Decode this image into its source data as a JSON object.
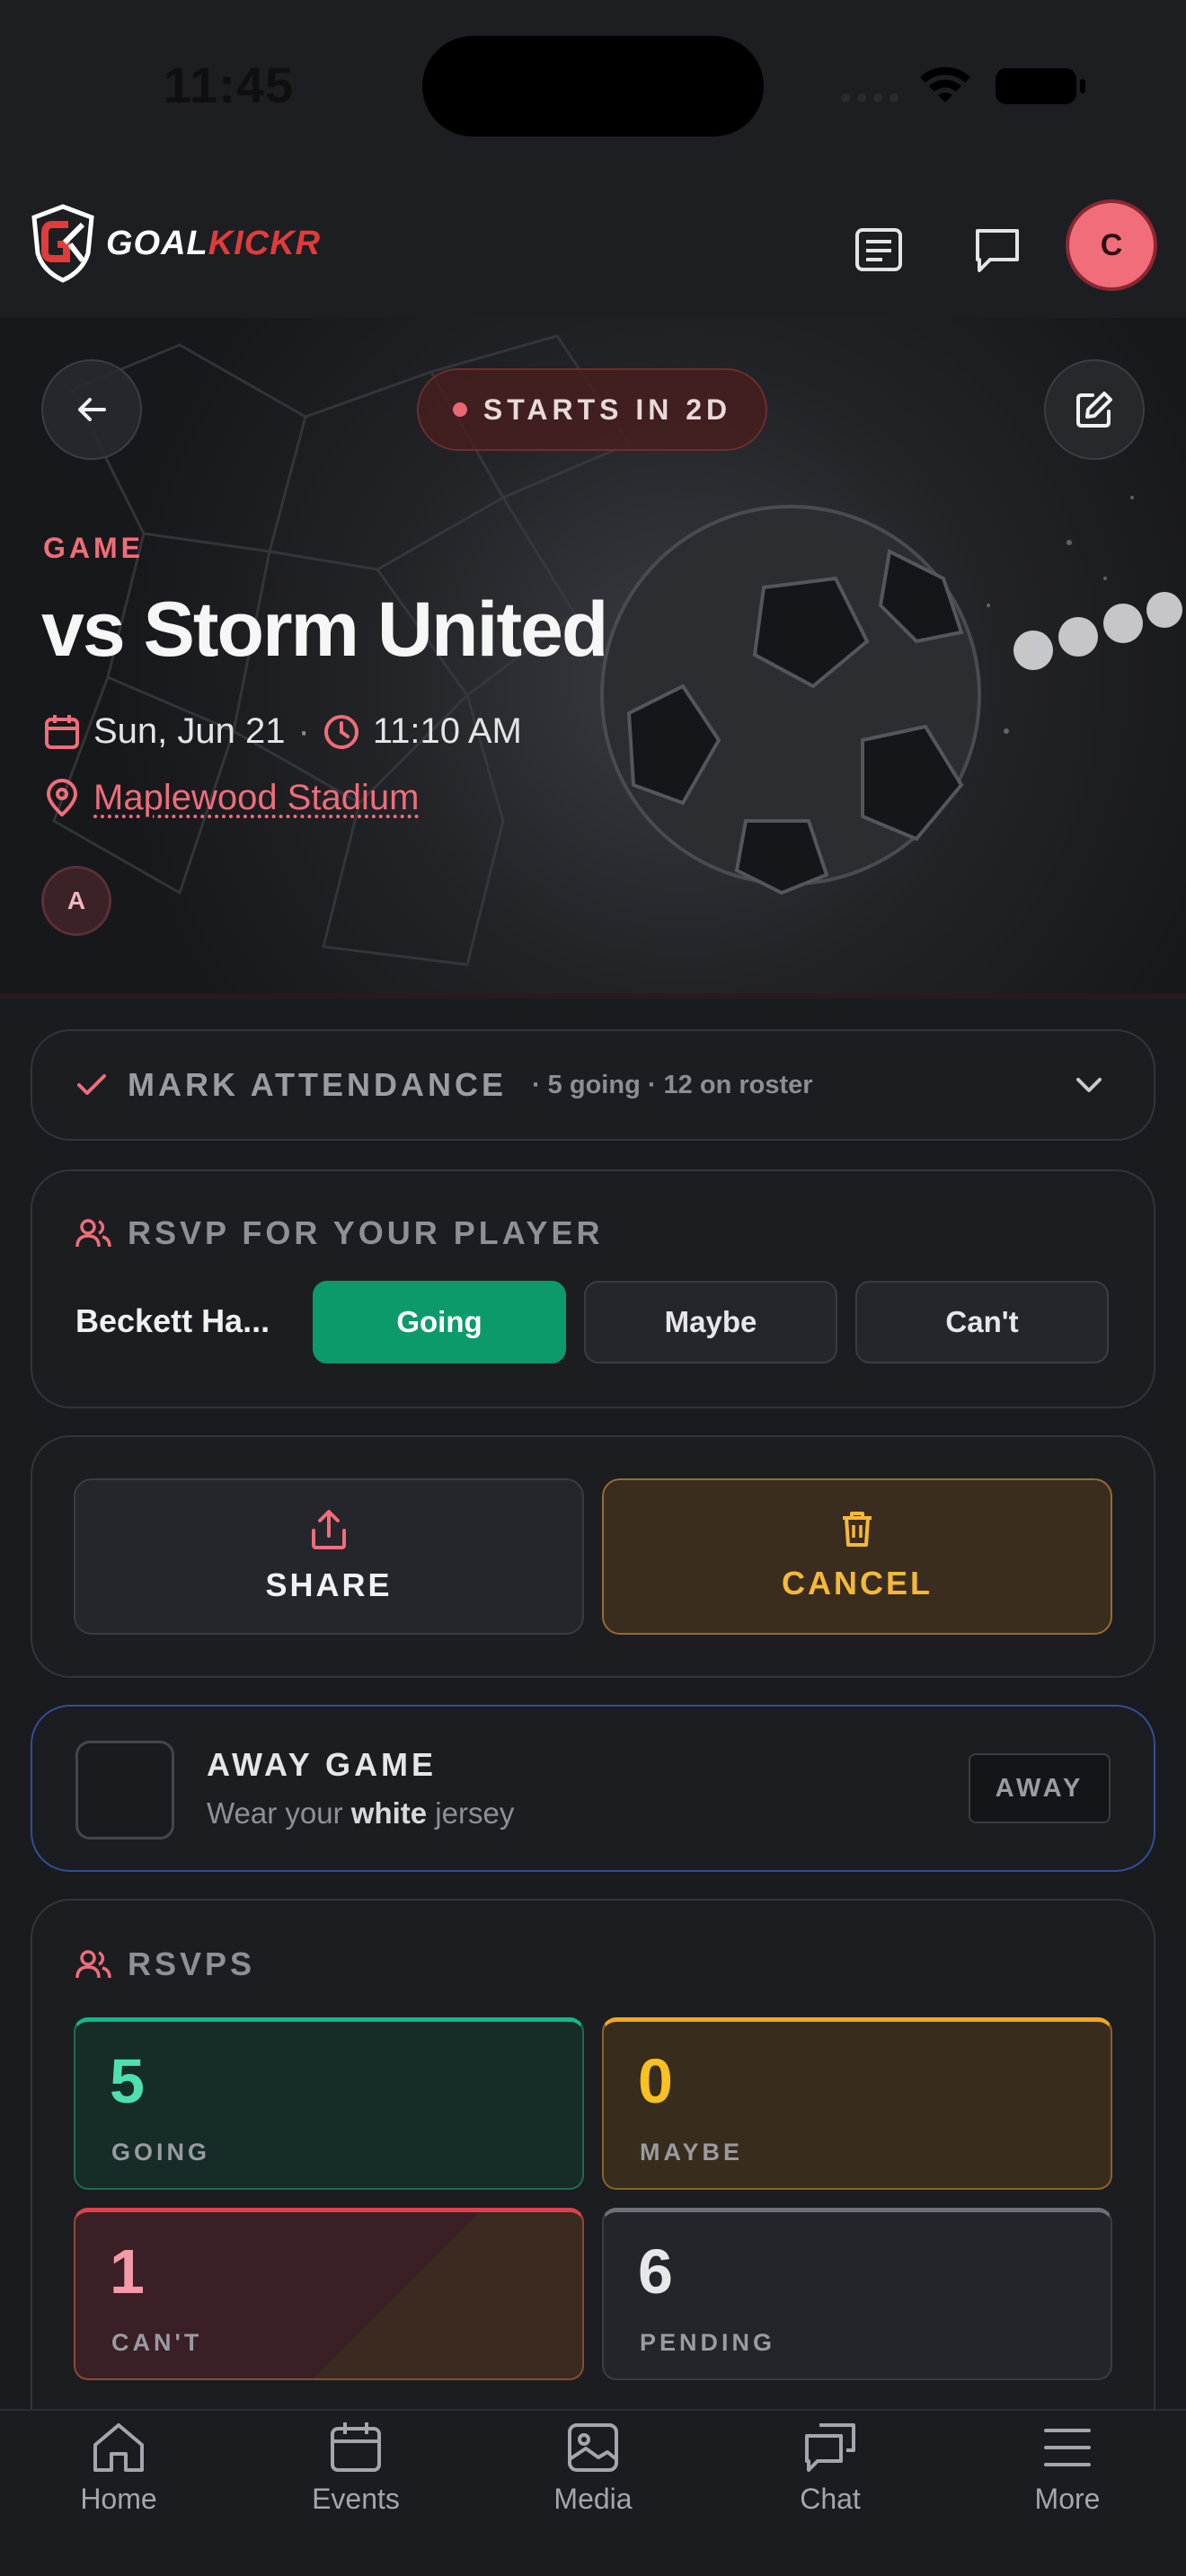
{
  "status_bar": {
    "time": "11:45"
  },
  "header": {
    "logo_word_1": "GOAL",
    "logo_word_2": "KICKR",
    "avatar_initial": "C"
  },
  "hero": {
    "countdown": "STARTS IN 2D",
    "event_type": "GAME",
    "title": "vs Storm United",
    "date": "Sun, Jun 21",
    "separator": "·",
    "time": "11:10 AM",
    "location": "Maplewood Stadium",
    "attendee_initial": "A"
  },
  "mark_attendance": {
    "label": "MARK ATTENDANCE",
    "summary": "· 5 going · 12 on roster"
  },
  "rsvp_player": {
    "heading": "RSVP FOR YOUR PLAYER",
    "player_name": "Beckett Ha...",
    "options": [
      "Going",
      "Maybe",
      "Can't"
    ],
    "selected": "Going"
  },
  "actions": {
    "share": "SHARE",
    "cancel": "CANCEL"
  },
  "away": {
    "title": "AWAY GAME",
    "sub_before": "Wear your ",
    "sub_bold": "white",
    "sub_after": " jersey",
    "badge": "AWAY"
  },
  "rsvps": {
    "heading": "RSVPS",
    "going": {
      "count": "5",
      "label": "GOING"
    },
    "maybe": {
      "count": "0",
      "label": "MAYBE"
    },
    "cant": {
      "count": "1",
      "label": "CAN'T"
    },
    "pending": {
      "count": "6",
      "label": "PENDING"
    }
  },
  "nav": [
    "Home",
    "Events",
    "Media",
    "Chat",
    "More"
  ],
  "colors": {
    "accent": "#f06d79",
    "going": "#0d9a6a",
    "cancel": "#f7b935",
    "away_border": "#2f4f9a"
  }
}
